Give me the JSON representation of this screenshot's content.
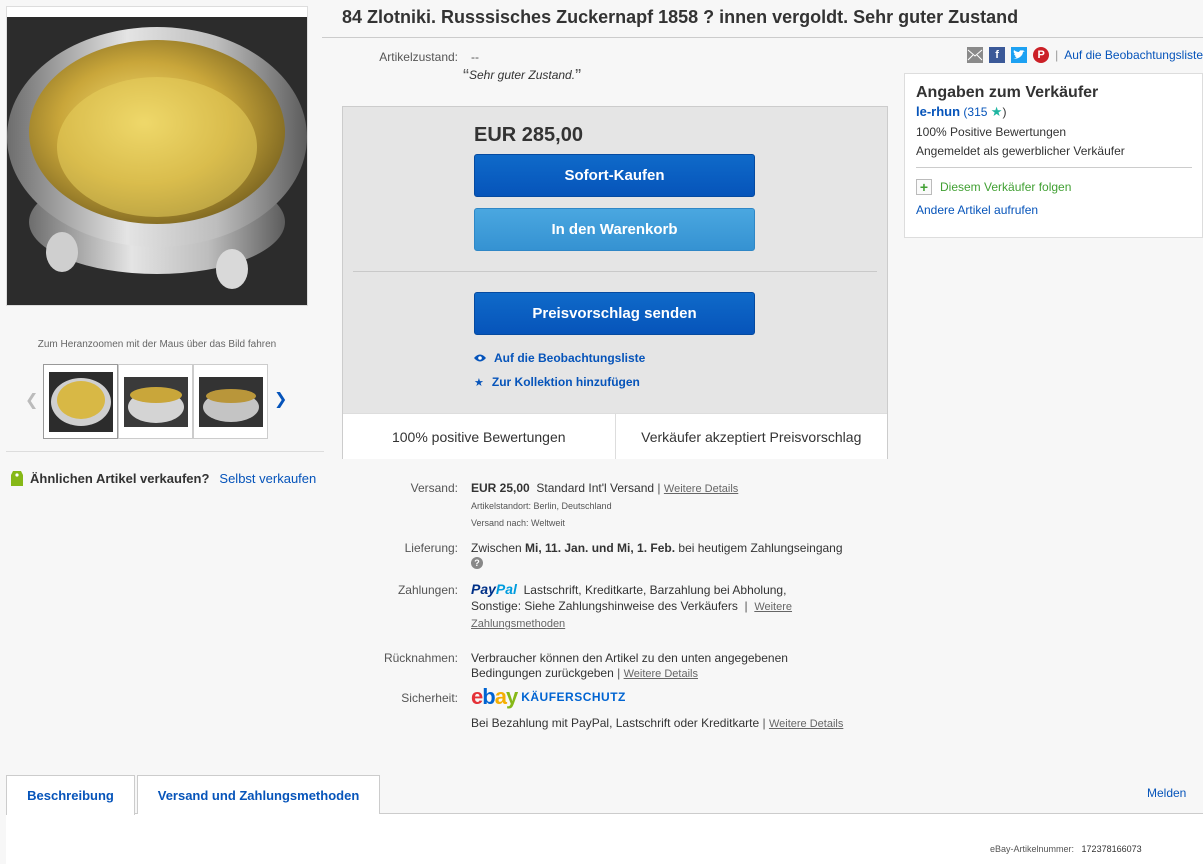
{
  "title": "84 Zlotniki. Russsisches Zuckernapf 1858 ? innen vergoldt. Sehr guter Zustand",
  "gallery": {
    "zoom_hint": "Zum Heranzoomen mit der Maus über das Bild fahren"
  },
  "sell_similar": {
    "question": "Ähnlichen Artikel verkaufen?",
    "link": "Selbst verkaufen"
  },
  "share": {
    "watchlist_link": "Auf die Beobachtungsliste"
  },
  "condition": {
    "label": "Artikelzustand:",
    "value": "--",
    "quote": "Sehr guter Zustand."
  },
  "buybox": {
    "price": "EUR 285,00",
    "buy_now": "Sofort-Kaufen",
    "add_to_cart": "In den Warenkorb",
    "make_offer": "Preisvorschlag senden",
    "watch": "Auf die Beobachtungsliste",
    "collection": "Zur Kollektion hinzufügen",
    "footer_left": "100% positive Bewertungen",
    "footer_right": "Verkäufer akzeptiert Preisvorschlag"
  },
  "seller": {
    "heading": "Angaben zum Verkäufer",
    "name": "le-rhun",
    "feedback_open": " (",
    "feedback_score": "315",
    "feedback_close": ")",
    "positive": "100% Positive Bewertungen",
    "type": "Angemeldet als gewerblicher Verkäufer",
    "follow": "Diesem Verkäufer folgen",
    "other_items": "Andere Artikel aufrufen"
  },
  "details": {
    "shipping_label": "Versand:",
    "shipping_cost": "EUR 25,00",
    "shipping_service": "Standard Int'l Versand",
    "more_details": "Weitere Details",
    "location": "Artikelstandort:  Berlin, Deutschland",
    "ships_to": "Versand nach:  Weltweit",
    "delivery_label": "Lieferung:",
    "delivery_prefix": "Zwischen ",
    "delivery_dates": "Mi, 11. Jan. und Mi, 1. Feb.",
    "delivery_suffix": " bei heutigem Zahlungseingang",
    "payment_label": "Zahlungen:",
    "paypal_a": "Pay",
    "paypal_b": "Pal",
    "payment_methods": "Lastschrift,  Kreditkarte,  Barzahlung bei Abholung,",
    "payment_other": "Sonstige: Siehe Zahlungshinweise des Verkäufers",
    "payment_link_a": "Weitere",
    "payment_link_b": "Zahlungsmethoden",
    "returns_label": "Rücknahmen:",
    "returns_line1": "Verbraucher können den Artikel zu den unten angegebenen",
    "returns_line2": "Bedingungen zurückgeben",
    "security_label": "Sicherheit:",
    "ebay_e": "e",
    "ebay_b": "b",
    "ebay_a": "a",
    "ebay_y": "y",
    "buyer_protection": "KÄUFERSCHUTZ",
    "security_text": "Bei Bezahlung mit PayPal, Lastschrift oder Kreditkarte"
  },
  "tabs": {
    "description": "Beschreibung",
    "shipping_payment": "Versand und Zahlungsmethoden",
    "report": "Melden"
  },
  "item_number": {
    "label": "eBay-Artikelnummer:",
    "value": "172378166073"
  }
}
